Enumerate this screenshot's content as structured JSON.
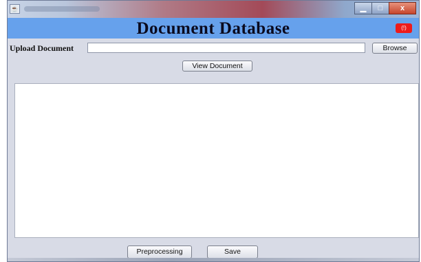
{
  "window": {
    "controls": {
      "minimize": "▁",
      "maximize": "□",
      "close": "x"
    },
    "app_icon": "java-icon"
  },
  "header": {
    "title": "Document Database",
    "badge": "(!)"
  },
  "upload": {
    "label": "Upload Document",
    "input_value": "",
    "browse_label": "Browse"
  },
  "actions": {
    "view_document_label": "View Document",
    "preprocessing_label": "Preprocessing",
    "save_label": "Save"
  },
  "colors": {
    "header_bg": "#66a1ec",
    "window_bg": "#d8dbe6",
    "badge_bg": "#ee1b1b"
  }
}
